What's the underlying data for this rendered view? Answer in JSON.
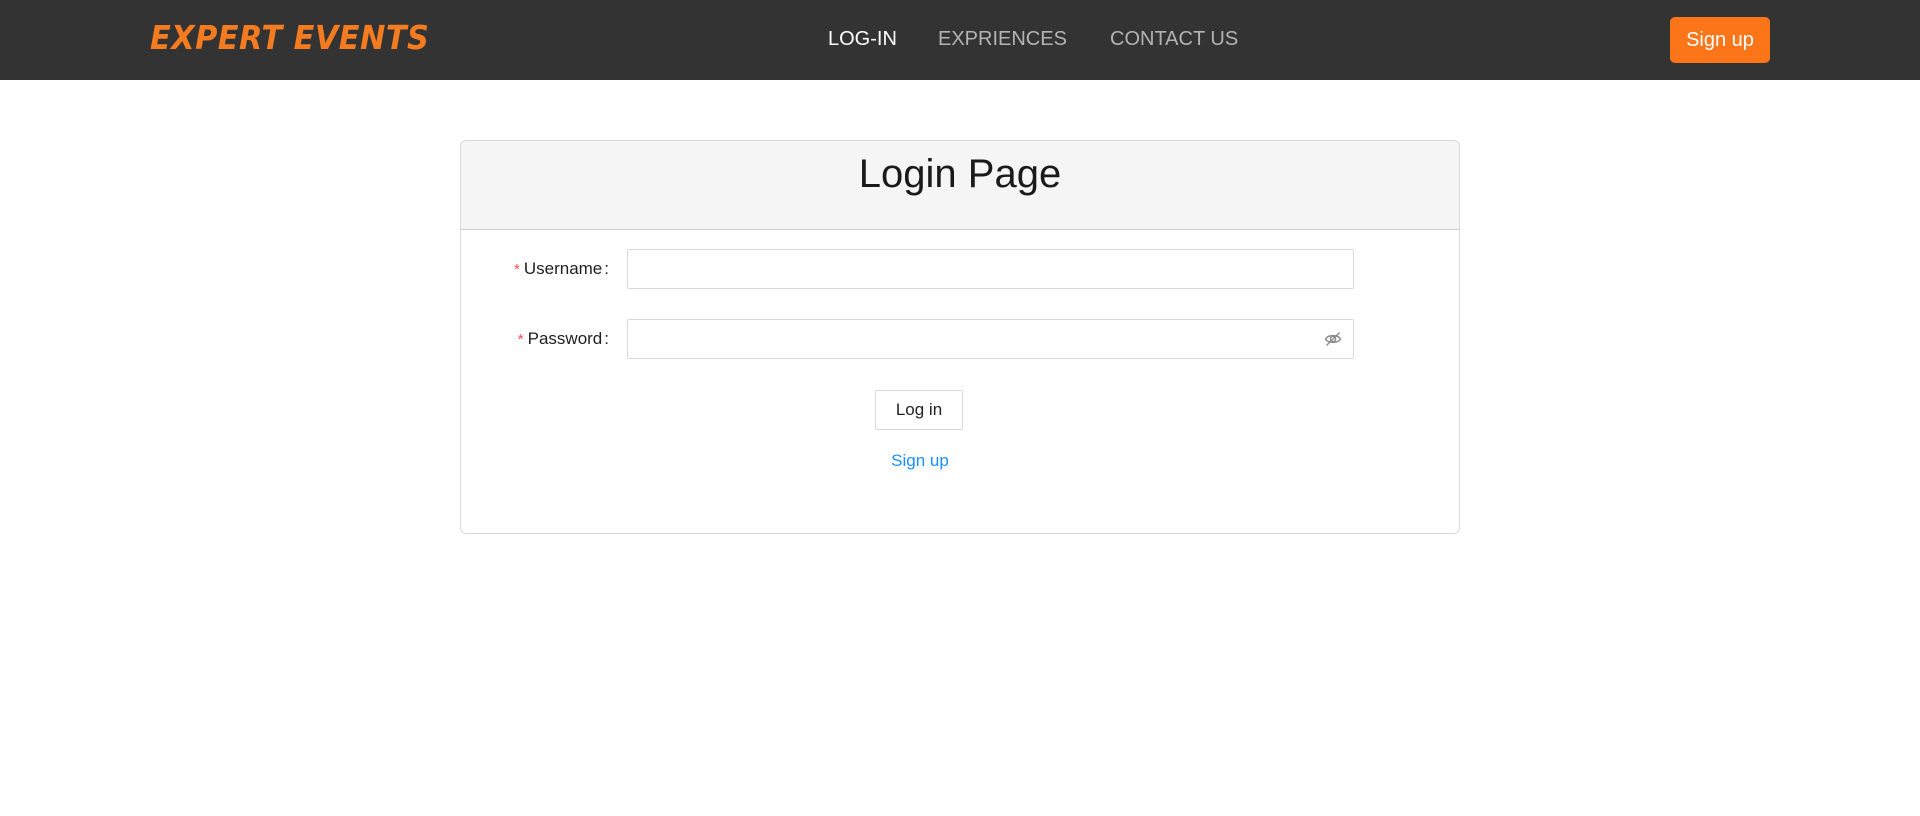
{
  "brand": {
    "name": "EXPERT EVENTS",
    "color": "#f47b20"
  },
  "nav": {
    "links": [
      {
        "label": "LOG-IN",
        "active": true
      },
      {
        "label": "EXPRIENCES",
        "active": false
      },
      {
        "label": "CONTACT US",
        "active": false
      }
    ],
    "signup_label": "Sign up"
  },
  "login": {
    "title": "Login Page",
    "username": {
      "required_mark": "*",
      "label": "Username",
      "colon": ":",
      "value": "",
      "placeholder": ""
    },
    "password": {
      "required_mark": "*",
      "label": "Password",
      "colon": ":",
      "value": "",
      "placeholder": ""
    },
    "submit_label": "Log in",
    "signup_link": "Sign up"
  },
  "colors": {
    "navbar_bg": "#333333",
    "accent": "#fd7519",
    "link": "#1890ff",
    "required": "#ff4d4f"
  },
  "icons": {
    "password_toggle": "eye-invisible-icon"
  }
}
